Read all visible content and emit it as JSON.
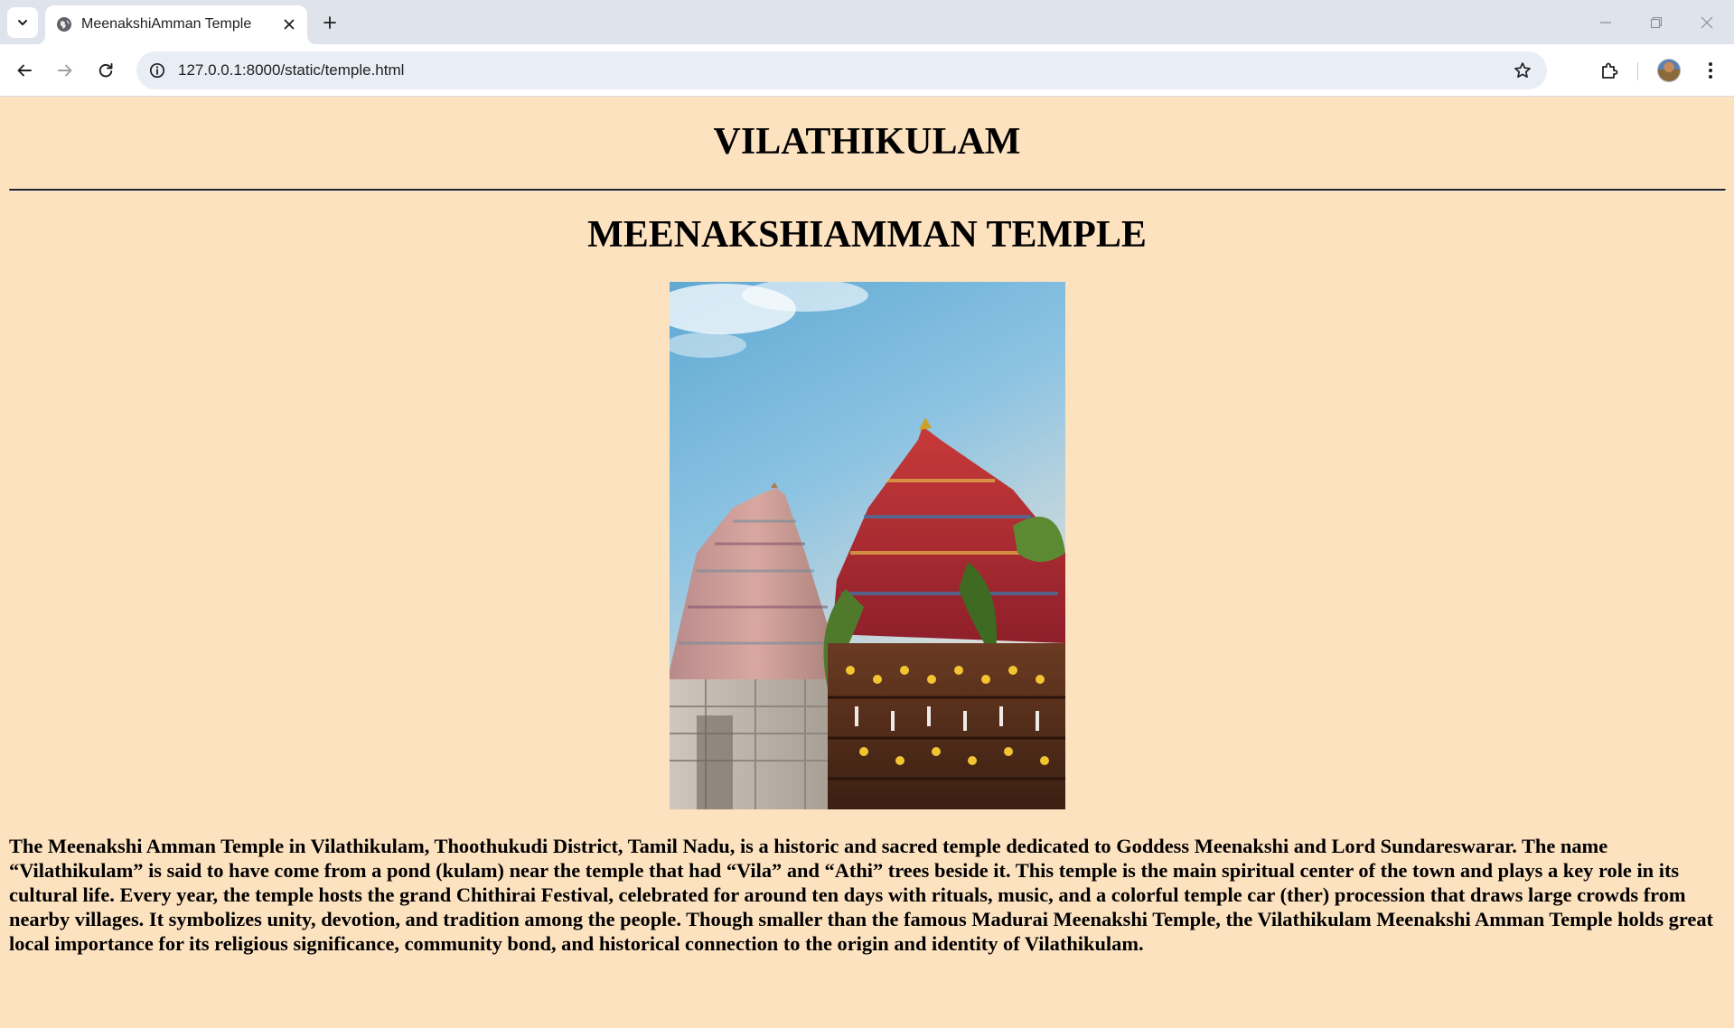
{
  "browser": {
    "tab": {
      "title": "MeenakshiAmman Temple"
    },
    "address_bar": {
      "url": "127.0.0.1:8000/static/temple.html"
    }
  },
  "page": {
    "site_title": "VILATHIKULAM",
    "heading": "MEENAKSHIAMMAN TEMPLE",
    "image": {
      "alt": "Meenakshi Amman Temple gopuram and temple car"
    },
    "description": "The Meenakshi Amman Temple in Vilathikulam, Thoothukudi District, Tamil Nadu, is a historic and sacred temple dedicated to Goddess Meenakshi and Lord Sundareswarar. The name “Vilathikulam” is said to have come from a pond (kulam) near the temple that had “Vila” and “Athi” trees beside it. This temple is the main spiritual center of the town and plays a key role in its cultural life. Every year, the temple hosts the grand Chithirai Festival, celebrated for around ten days with rituals, music, and a colorful temple car (ther) procession that draws large crowds from nearby villages. It symbolizes unity, devotion, and tradition among the people. Though smaller than the famous Madurai Meenakshi Temple, the Vilathikulam Meenakshi Amman Temple holds great local importance for its religious significance, community bond, and historical connection to the origin and identity of Vilathikulam."
  },
  "colors": {
    "page_background": "#fde2c0",
    "tabbar_background": "#dfe3eb",
    "omnibox_background": "#e9edf5"
  }
}
